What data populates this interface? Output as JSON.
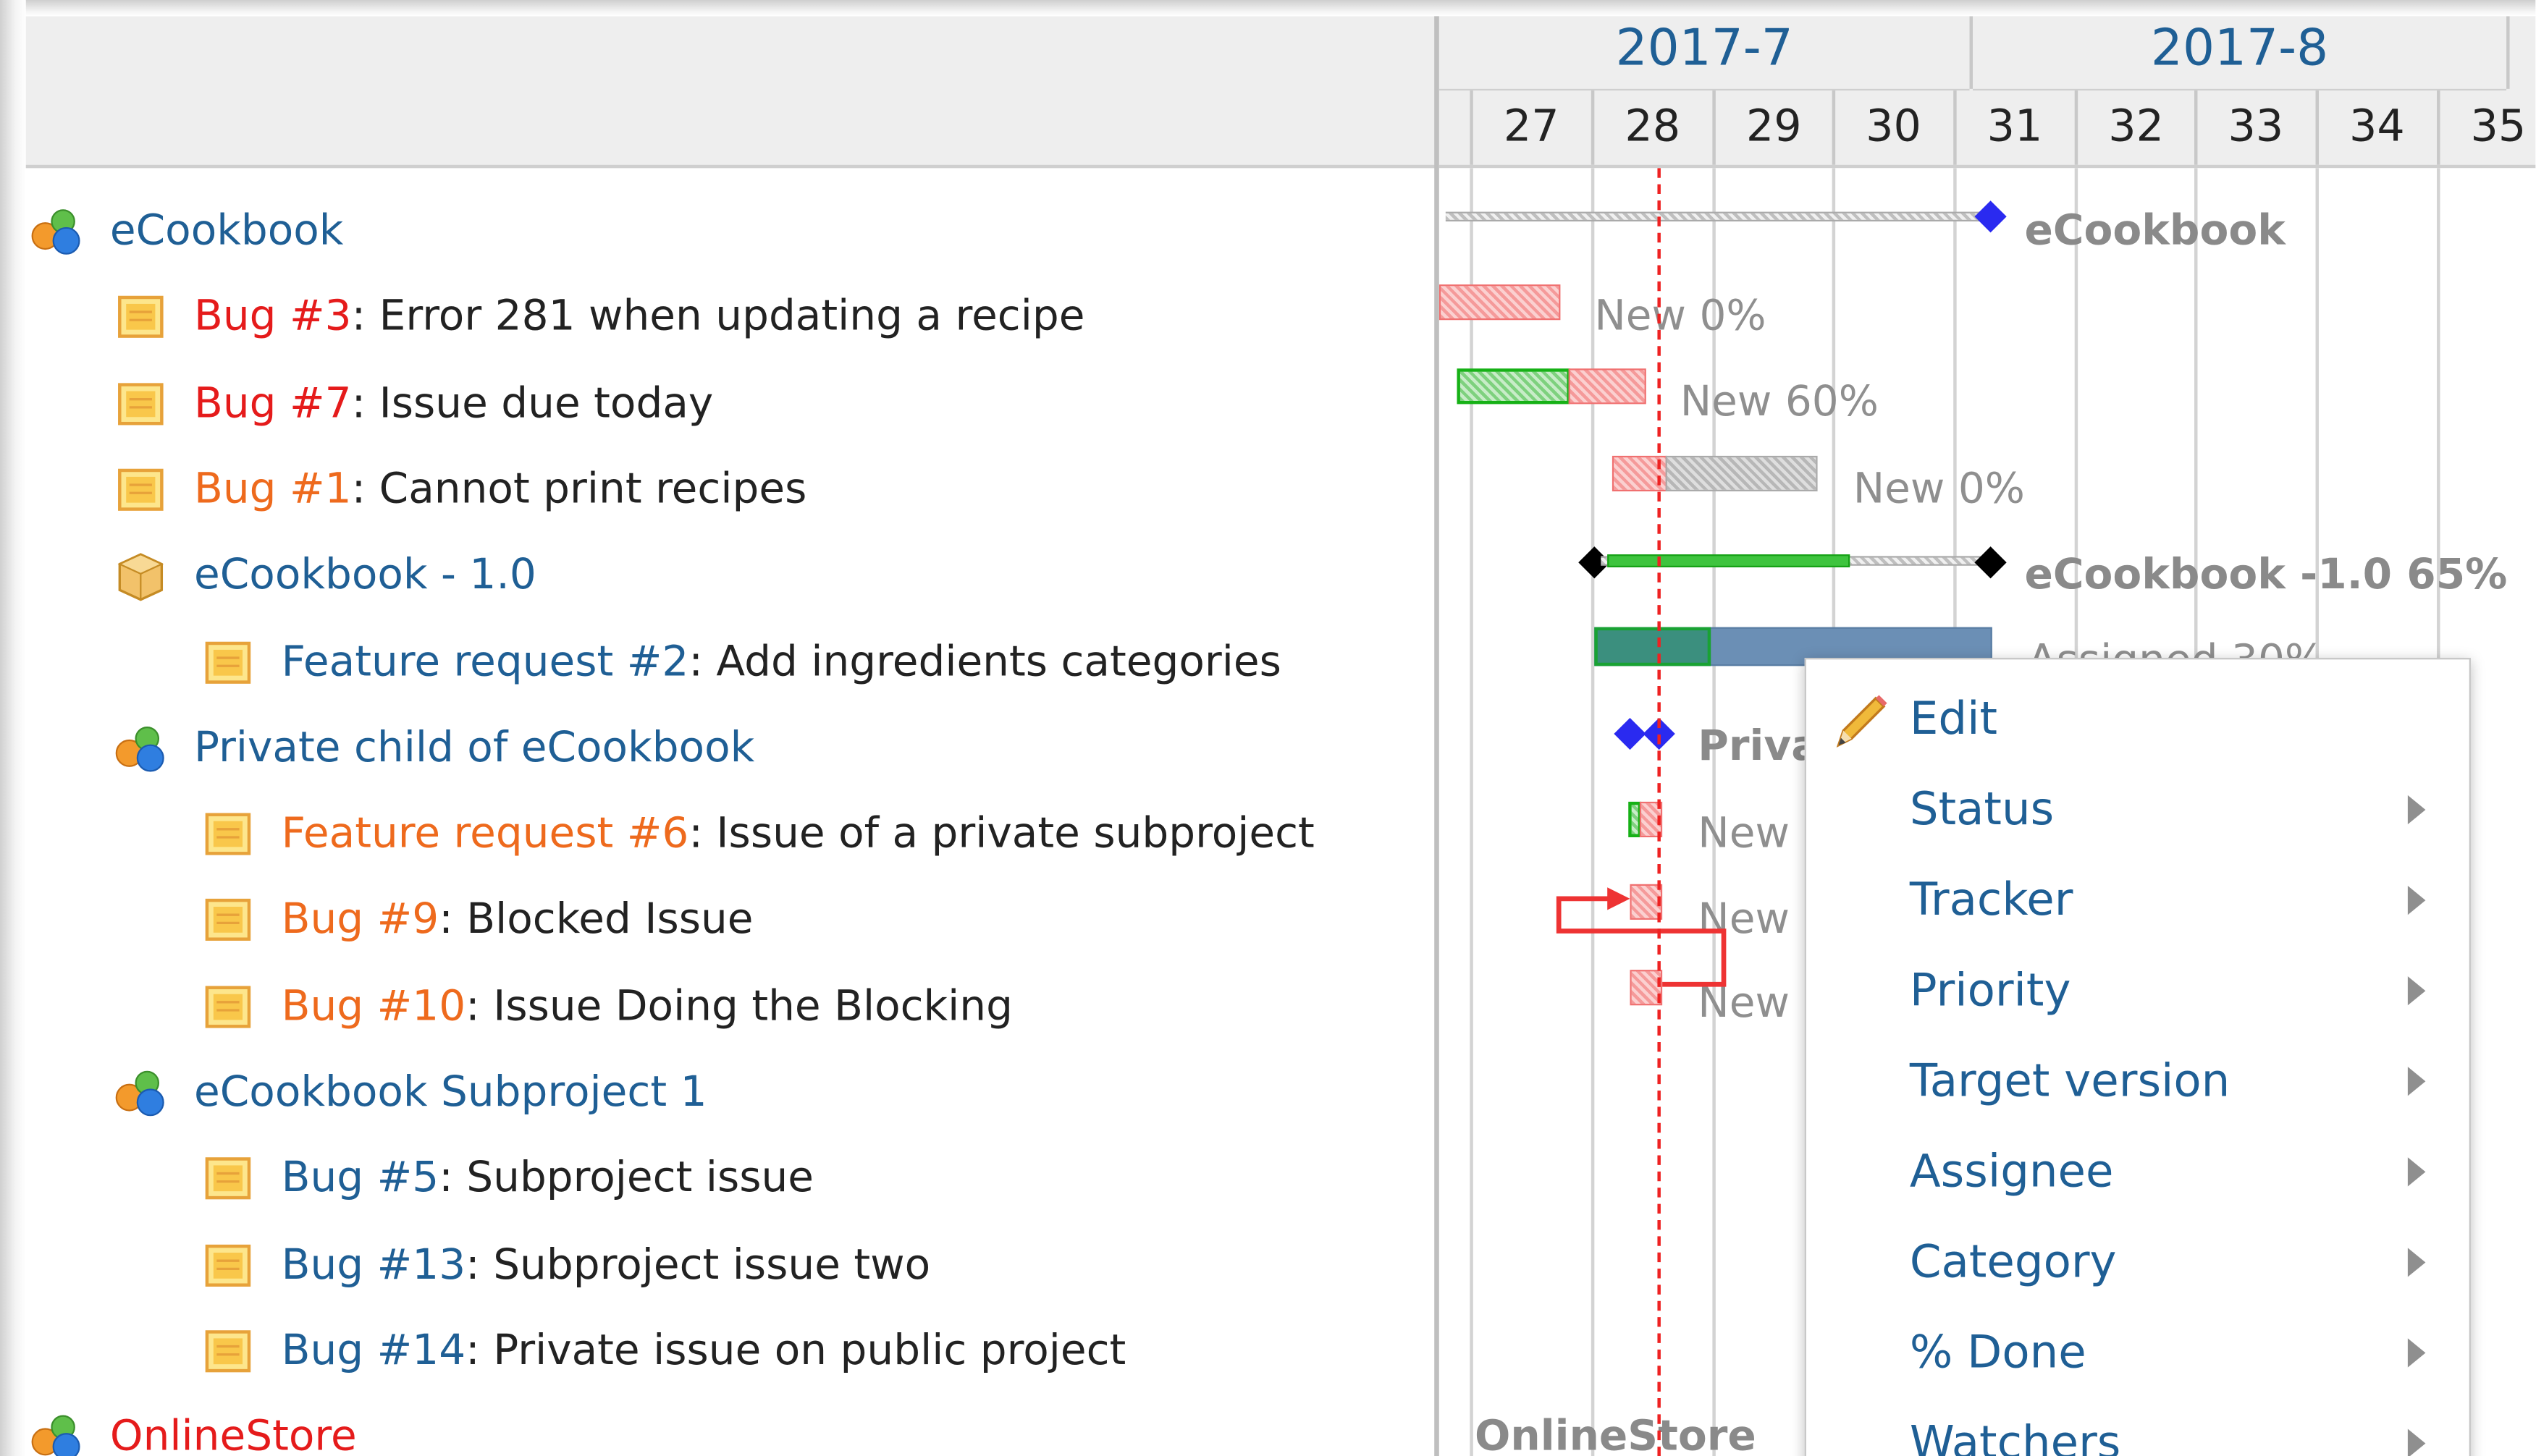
{
  "header": {
    "months": [
      "2017-7",
      "2017-8"
    ],
    "weeks": [
      "27",
      "28",
      "29",
      "30",
      "31",
      "32",
      "33",
      "34",
      "35"
    ]
  },
  "subjects": [
    {
      "kind": "project",
      "indent": 0,
      "prefix": "eCookbook",
      "title": "",
      "color": "blue",
      "icon": "project-icon"
    },
    {
      "kind": "issue",
      "indent": 1,
      "prefix": "Bug #3",
      "title": ": Error 281 when updating a recipe",
      "color": "red",
      "icon": "issue-icon"
    },
    {
      "kind": "issue",
      "indent": 1,
      "prefix": "Bug #7",
      "title": ": Issue due today",
      "color": "red",
      "icon": "issue-icon"
    },
    {
      "kind": "issue",
      "indent": 1,
      "prefix": "Bug #1",
      "title": ": Cannot print recipes",
      "color": "orange",
      "icon": "issue-icon"
    },
    {
      "kind": "version",
      "indent": 1,
      "prefix": "eCookbook - 1.0",
      "title": "",
      "color": "blue",
      "icon": "version-icon"
    },
    {
      "kind": "issue",
      "indent": 2,
      "prefix": "Feature request #2",
      "title": ": Add ingredients categories",
      "color": "blue",
      "icon": "issue-icon"
    },
    {
      "kind": "project",
      "indent": 1,
      "prefix": "Private child of eCookbook",
      "title": "",
      "color": "blue",
      "icon": "project-icon"
    },
    {
      "kind": "issue",
      "indent": 2,
      "prefix": "Feature request #6",
      "title": ": Issue of a private subproject",
      "color": "orange",
      "icon": "issue-icon"
    },
    {
      "kind": "issue",
      "indent": 2,
      "prefix": "Bug #9",
      "title": ": Blocked Issue",
      "color": "orange",
      "icon": "issue-icon"
    },
    {
      "kind": "issue",
      "indent": 2,
      "prefix": "Bug #10",
      "title": ": Issue Doing the Blocking",
      "color": "orange",
      "icon": "issue-icon"
    },
    {
      "kind": "project",
      "indent": 1,
      "prefix": "eCookbook Subproject 1",
      "title": "",
      "color": "blue",
      "icon": "project-icon"
    },
    {
      "kind": "issue",
      "indent": 2,
      "prefix": "Bug #5",
      "title": ": Subproject issue",
      "color": "blue",
      "icon": "issue-icon"
    },
    {
      "kind": "issue",
      "indent": 2,
      "prefix": "Bug #13",
      "title": ": Subproject issue two",
      "color": "blue",
      "icon": "issue-icon"
    },
    {
      "kind": "issue",
      "indent": 2,
      "prefix": "Bug #14",
      "title": ": Private issue on public project",
      "color": "blue",
      "icon": "issue-icon"
    },
    {
      "kind": "project",
      "indent": 0,
      "prefix": "OnlineStore",
      "title": "",
      "color": "red",
      "icon": "project-icon"
    }
  ],
  "gantt_labels": {
    "row0": "eCookbook",
    "row1": "New 0%",
    "row2": "New 60%",
    "row3": "New 0%",
    "row4": "eCookbook -1.0 65%",
    "row5": "Assigned 30%",
    "row6": "Priva",
    "row7": "New",
    "row8": "New",
    "row9": "New",
    "row14": "OnlineStore"
  },
  "context_menu": {
    "items": [
      {
        "label": "Edit",
        "icon": "pencil-icon",
        "submenu": false
      },
      {
        "label": "Status",
        "submenu": true
      },
      {
        "label": "Tracker",
        "submenu": true
      },
      {
        "label": "Priority",
        "submenu": true
      },
      {
        "label": "Target version",
        "submenu": true
      },
      {
        "label": "Assignee",
        "submenu": true
      },
      {
        "label": "Category",
        "submenu": true
      },
      {
        "label": "% Done",
        "submenu": true
      },
      {
        "label": "Watchers",
        "submenu": true
      }
    ]
  },
  "colors": {
    "link_blue": "#1f5f95",
    "link_red": "#e51b1b",
    "link_orange": "#ee6a1d",
    "today_line": "#ee2222",
    "relation_arrow": "#ee3333"
  }
}
